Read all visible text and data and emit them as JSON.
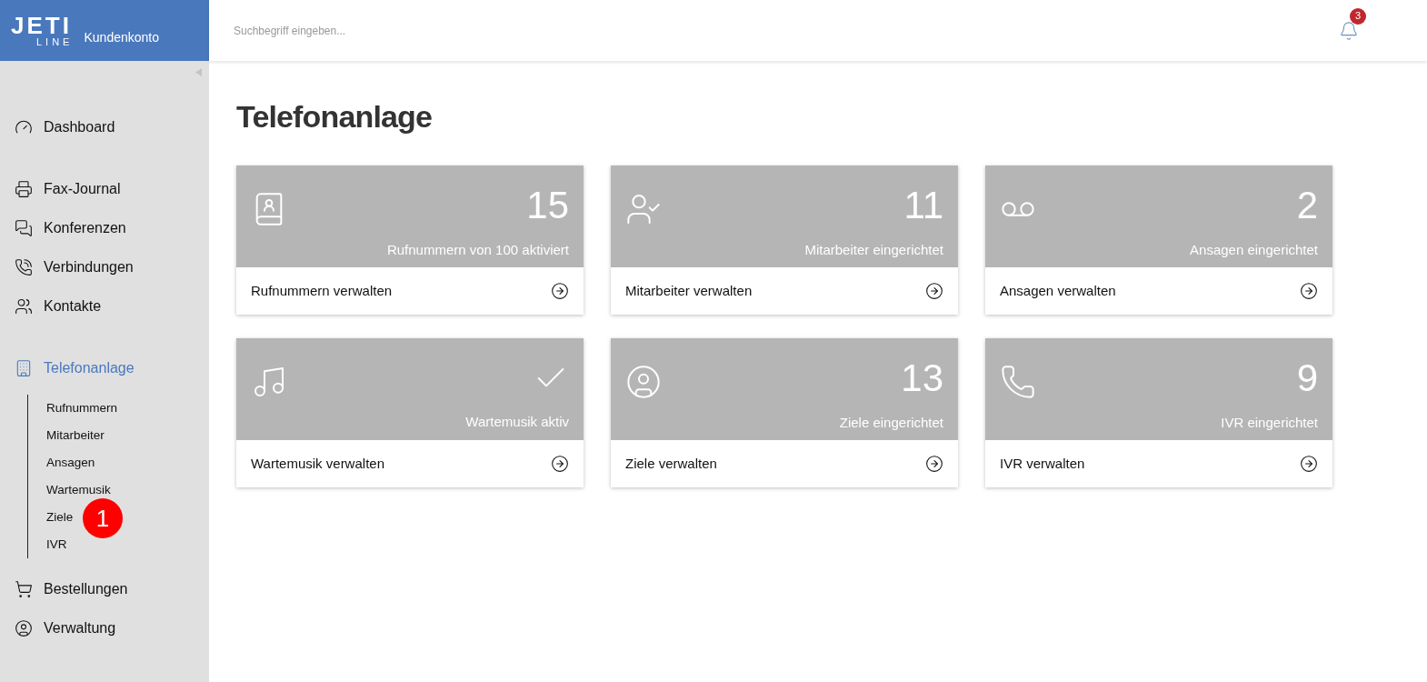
{
  "logo": {
    "word_top": "JETI",
    "word_bottom": "LINE",
    "product": "Kundenkonto"
  },
  "search": {
    "placeholder": "Suchbegriff eingeben..."
  },
  "notifications": {
    "count": "3"
  },
  "sidebar": {
    "sections": [
      {
        "items": [
          {
            "label": "Dashboard",
            "selected": false
          }
        ]
      },
      {
        "items": [
          {
            "label": "Fax-Journal",
            "selected": false
          },
          {
            "label": "Konferenzen",
            "selected": false
          },
          {
            "label": "Verbindungen",
            "selected": false
          },
          {
            "label": "Kontakte",
            "selected": false
          }
        ]
      },
      {
        "items": [
          {
            "label": "Telefonanlage",
            "selected": true,
            "children": [
              {
                "label": "Rufnummern",
                "selected": false
              },
              {
                "label": "Mitarbeiter",
                "selected": false
              },
              {
                "label": "Ansagen",
                "selected": false
              },
              {
                "label": "Wartemusik",
                "selected": false
              },
              {
                "label": "Ziele",
                "selected": false,
                "callout": "1"
              },
              {
                "label": "IVR",
                "selected": false
              }
            ]
          },
          {
            "label": "Bestellungen",
            "selected": false
          },
          {
            "label": "Verwaltung",
            "selected": false
          }
        ]
      }
    ]
  },
  "page": {
    "title": "Telefonanlage"
  },
  "cards": [
    {
      "kind": "count",
      "value": "15",
      "caption": "Rufnummern von 100 aktiviert",
      "link": "Rufnummern verwalten"
    },
    {
      "kind": "count",
      "value": "11",
      "caption": "Mitarbeiter eingerichtet",
      "link": "Mitarbeiter verwalten"
    },
    {
      "kind": "count",
      "value": "2",
      "caption": "Ansagen eingerichtet",
      "link": "Ansagen verwalten"
    },
    {
      "kind": "check",
      "caption": "Wartemusik aktiv",
      "link": "Wartemusik verwalten"
    },
    {
      "kind": "count",
      "value": "13",
      "caption": "Ziele eingerichtet",
      "link": "Ziele verwalten"
    },
    {
      "kind": "count",
      "value": "9",
      "caption": "IVR eingerichtet",
      "link": "IVR verwalten"
    }
  ]
}
